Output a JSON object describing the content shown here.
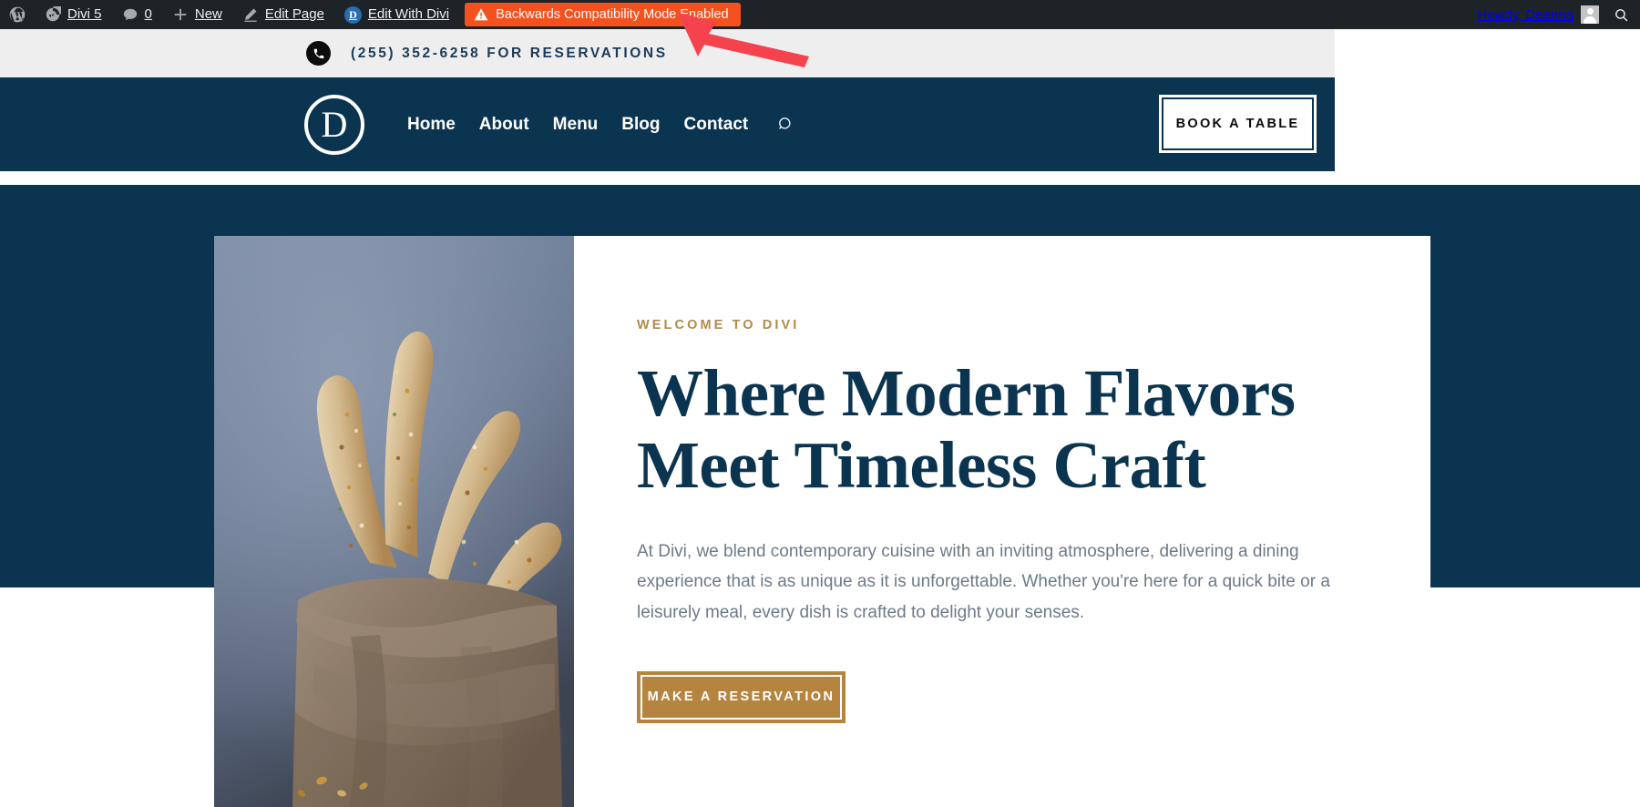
{
  "adminbar": {
    "wp_logo": "wordpress-logo-icon",
    "site_name": "Divi 5",
    "comments_count": "0",
    "new_label": "New",
    "edit_page_label": "Edit Page",
    "edit_with_divi_label": "Edit With Divi",
    "divi_badge_letter": "D",
    "compat_badge": "Backwards Compatibility Mode Enabled",
    "compat_badge_color": "#f4511e",
    "howdy": "Howdy, Deanna",
    "search_icon": "search-icon",
    "bar_color": "#1d2327"
  },
  "topbar": {
    "phone_icon": "phone-icon",
    "phone_text": "(255) 352-6258 FOR RESERVATIONS",
    "background": "#eeeeee",
    "text_color": "#1c3a56"
  },
  "header": {
    "logo_letter": "D",
    "nav": [
      {
        "label": "Home"
      },
      {
        "label": "About"
      },
      {
        "label": "Menu"
      },
      {
        "label": "Blog"
      },
      {
        "label": "Contact"
      }
    ],
    "search_icon": "search-icon",
    "book_button": "BOOK A TABLE",
    "background": "#0b3450"
  },
  "hero": {
    "eyebrow": "WELCOME TO DIVI",
    "eyebrow_color": "#b08a4a",
    "title_line1": "Where Modern Flavors",
    "title_line2": "Meet Timeless Craft",
    "title_color": "#0b3450",
    "paragraph": "At Divi, we blend contemporary cuisine with an inviting atmosphere, delivering a dining experience that is as unique as it is unforgettable. Whether you're here for a quick bite or a leisurely meal, every dish is crafted to delight your senses.",
    "cta_label": "MAKE A RESERVATION",
    "cta_color": "#b5843f",
    "photo_alt": "seeded-breadsticks-in-paper-bag-photo"
  },
  "annotation": {
    "arrow_color": "#f4424f",
    "arrow_target": "Backwards Compatibility Mode Enabled"
  }
}
